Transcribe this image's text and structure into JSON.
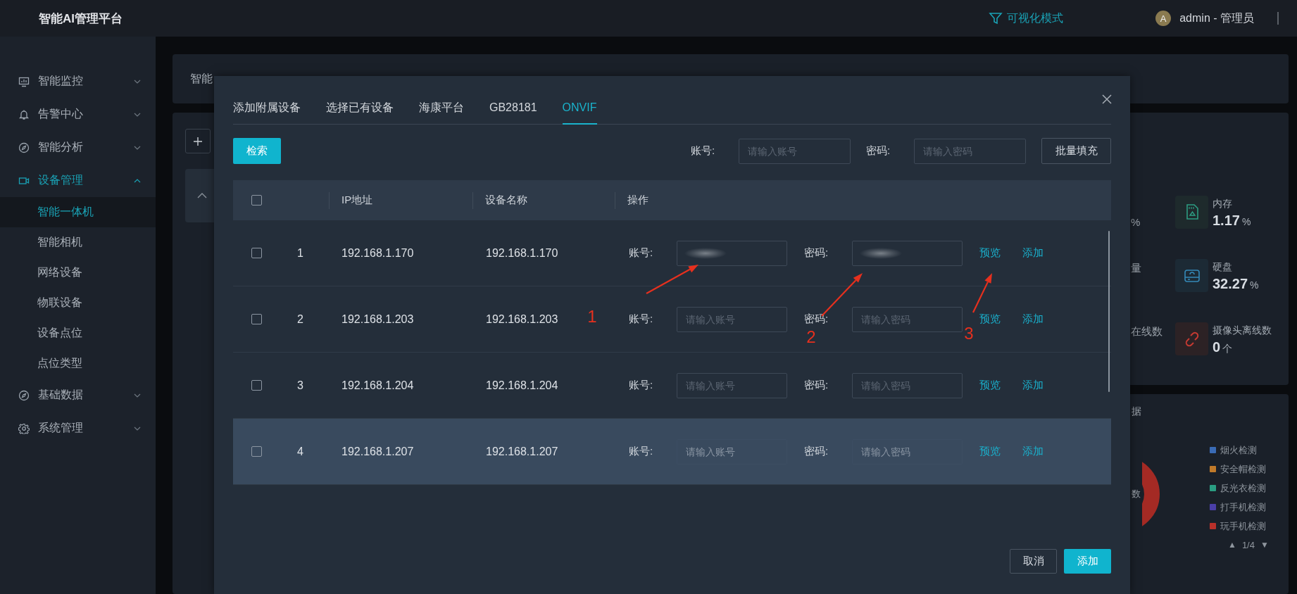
{
  "topbar": {
    "title": "智能AI管理平台",
    "mode_link": "可视化模式",
    "avatar": "A",
    "user": "admin - 管理员"
  },
  "sidebar": {
    "items": [
      {
        "label": "智能监控",
        "expanded": false,
        "selected": false
      },
      {
        "label": "告警中心",
        "expanded": false,
        "selected": false
      },
      {
        "label": "智能分析",
        "expanded": false,
        "selected": false
      },
      {
        "label": "设备管理",
        "expanded": true,
        "selected": true,
        "children": [
          {
            "label": "智能一体机",
            "selected": true
          },
          {
            "label": "智能相机",
            "selected": false
          },
          {
            "label": "网络设备",
            "selected": false
          },
          {
            "label": "物联设备",
            "selected": false
          },
          {
            "label": "设备点位",
            "selected": false
          },
          {
            "label": "点位类型",
            "selected": false
          }
        ]
      },
      {
        "label": "基础数据",
        "expanded": false,
        "selected": false
      },
      {
        "label": "系统管理",
        "expanded": false,
        "selected": false
      }
    ]
  },
  "breadcrumb": {
    "text": "智能"
  },
  "stats": {
    "fragments": [
      {
        "kind": "value",
        "text": "%"
      },
      {
        "kind": "label",
        "text": "量"
      },
      {
        "kind": "label",
        "text": "在线数"
      }
    ],
    "items": [
      {
        "label": "内存",
        "value": "1.17",
        "unit": "%"
      },
      {
        "label": "硬盘",
        "value": "32.27",
        "unit": "%"
      },
      {
        "label": "摄像头离线数",
        "value": "0",
        "unit": "个"
      }
    ]
  },
  "chart_panel": {
    "title_fragment": "据",
    "center_fragment": "数",
    "legend": [
      {
        "label": "烟火检测",
        "color": "#3a6bb5"
      },
      {
        "label": "安全帽检测",
        "color": "#c07a2a"
      },
      {
        "label": "反光衣检测",
        "color": "#2a9d82"
      },
      {
        "label": "打手机检测",
        "color": "#4a3fa8"
      },
      {
        "label": "玩手机检测",
        "color": "#b8302a"
      }
    ],
    "pager": {
      "prev": "▲",
      "page": "1/4",
      "next": "▼"
    }
  },
  "dialog": {
    "tabs": [
      {
        "label": "添加附属设备",
        "selected": false
      },
      {
        "label": "选择已有设备",
        "selected": false
      },
      {
        "label": "海康平台",
        "selected": false
      },
      {
        "label": "GB28181",
        "selected": false
      },
      {
        "label": "ONVIF",
        "selected": true
      }
    ],
    "search_button": "检索",
    "batch": {
      "account_label": "账号:",
      "account_placeholder": "请输入账号",
      "password_label": "密码:",
      "password_placeholder": "请输入密码",
      "fill_button": "批量填充"
    },
    "table": {
      "header_checked": false,
      "columns": [
        "IP地址",
        "设备名称",
        "操作"
      ],
      "rows": [
        {
          "index": "1",
          "ip": "192.168.1.170",
          "name": "192.168.1.170",
          "checked": false,
          "hovered": false,
          "account_label": "账号:",
          "account": {
            "redacted": true
          },
          "password_label": "密码:",
          "password": {
            "redacted": true
          },
          "actions": [
            "预览",
            "添加"
          ]
        },
        {
          "index": "2",
          "ip": "192.168.1.203",
          "name": "192.168.1.203",
          "checked": false,
          "hovered": false,
          "account_label": "账号:",
          "account": {
            "redacted": false,
            "placeholder": "请输入账号"
          },
          "password_label": "密码:",
          "password": {
            "redacted": false,
            "placeholder": "请输入密码"
          },
          "actions": [
            "预览",
            "添加"
          ]
        },
        {
          "index": "3",
          "ip": "192.168.1.204",
          "name": "192.168.1.204",
          "checked": false,
          "hovered": false,
          "account_label": "账号:",
          "account": {
            "redacted": false,
            "placeholder": "请输入账号"
          },
          "password_label": "密码:",
          "password": {
            "redacted": false,
            "placeholder": "请输入密码"
          },
          "actions": [
            "预览",
            "添加"
          ]
        },
        {
          "index": "4",
          "ip": "192.168.1.207",
          "name": "192.168.1.207",
          "checked": false,
          "hovered": true,
          "account_label": "账号:",
          "account": {
            "redacted": false,
            "placeholder": "请输入账号"
          },
          "password_label": "密码:",
          "password": {
            "redacted": false,
            "placeholder": "请输入密码"
          },
          "actions": [
            "预览",
            "添加"
          ]
        }
      ]
    },
    "annotations": [
      {
        "label": "1"
      },
      {
        "label": "2"
      },
      {
        "label": "3"
      }
    ],
    "footer_buttons": [
      {
        "label": "取消",
        "kind": "secondary"
      },
      {
        "label": "添加",
        "kind": "primary"
      }
    ]
  }
}
